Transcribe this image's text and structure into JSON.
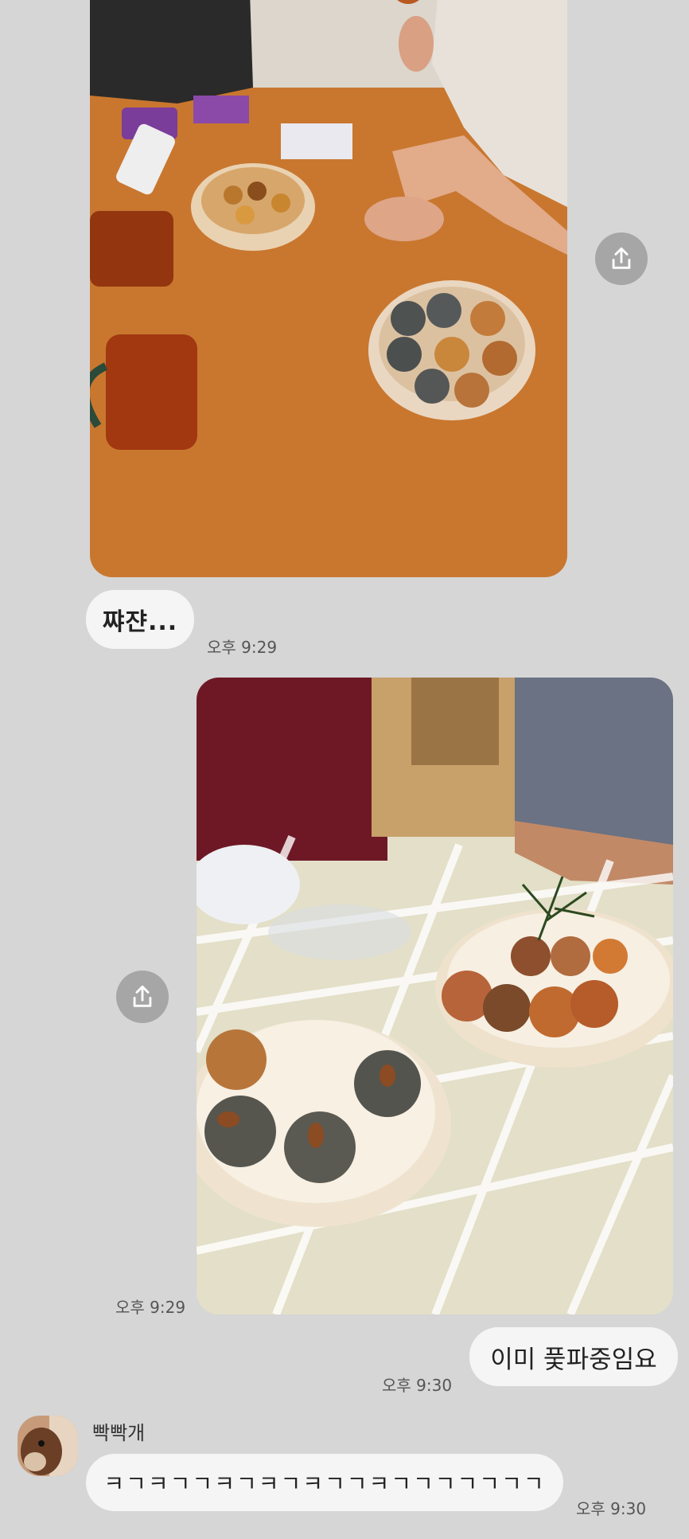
{
  "messages": {
    "photo_1": {
      "share_icon": "share-icon"
    },
    "text_1": {
      "text": "쨔쟌...",
      "time": "오후 9:29"
    },
    "photo_2": {
      "time": "오후 9:29",
      "share_icon": "share-icon"
    },
    "text_2": {
      "text": "이미 풏파중임요",
      "time": "오후 9:30"
    },
    "incoming": {
      "sender": "빡빡개",
      "text": "ㅋㄱㅋㄱㄱㅋㄱㅋㄱㅋㄱㄱㅋㄱㄱㄱㄱㄱㄱㄱ",
      "time": "오후 9:30"
    }
  },
  "colors": {
    "background": "#d6d6d6",
    "bubble": "#f5f5f5",
    "share_button": "#a6a6a6"
  }
}
